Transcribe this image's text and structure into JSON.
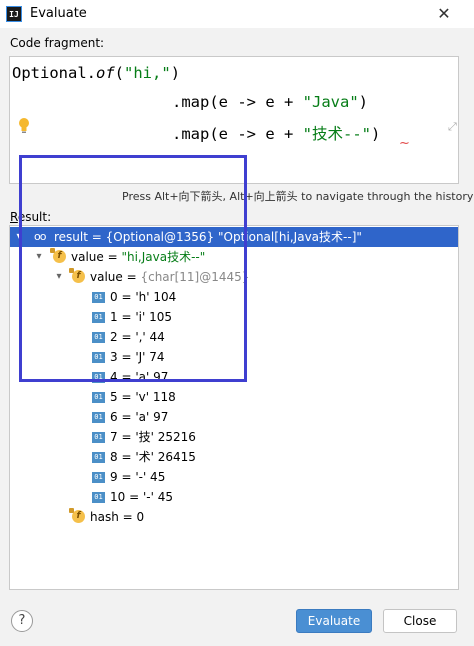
{
  "window": {
    "app_icon_text": "IJ",
    "title": "Evaluate",
    "close": "✕"
  },
  "code": {
    "label": "Code fragment:",
    "line1": {
      "a": "Optional.",
      "b": "of",
      "c": "(",
      "d": "\"hi,\"",
      "e": ")"
    },
    "line2": {
      "a": ".map(e -> e + ",
      "b": "\"Java\"",
      "c": ")"
    },
    "line3": {
      "a": ".map(e -> e + ",
      "b": "\"技术--\"",
      "c": ")"
    }
  },
  "history_hint": "Press Alt+向下箭头, Alt+向上箭头 to navigate through the history",
  "result": {
    "label_underlined": "R",
    "label_rest": "esult:",
    "root": {
      "text": "result = {Optional@1356} \"Optional[hi,Java技术--]\""
    },
    "value_field": {
      "name": "value = ",
      "val": "\"hi,Java技术--\""
    },
    "array_field": {
      "name": "value = ",
      "val": "{char[11]@1445}"
    },
    "items": [
      "0 = 'h' 104",
      "1 = 'i' 105",
      "2 = ',' 44",
      "3 = 'J' 74",
      "4 = 'a' 97",
      "5 = 'v' 118",
      "6 = 'a' 97",
      "7 = '技' 25216",
      "8 = '术' 26415",
      "9 = '-' 45",
      "10 = '-' 45"
    ],
    "hash": "hash = 0"
  },
  "icons": {
    "field": "f",
    "primitive": "01",
    "help": "?"
  },
  "buttons": {
    "evaluate": "Evaluate",
    "close": "Close"
  }
}
